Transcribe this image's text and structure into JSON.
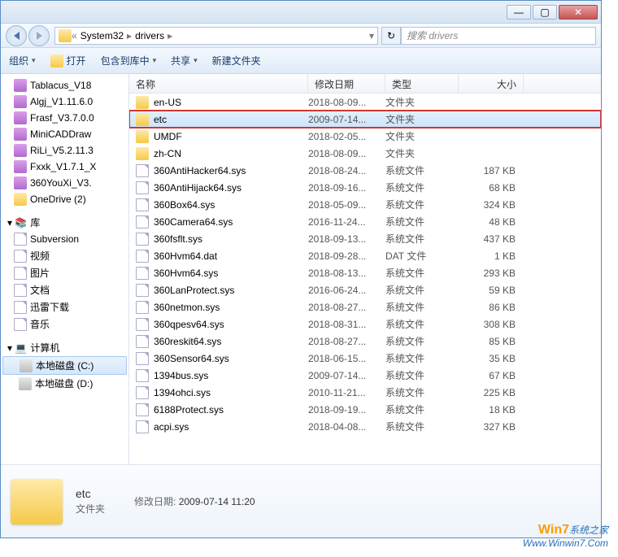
{
  "titlebar": {
    "min": "—",
    "max": "▢",
    "close": "✕"
  },
  "breadcrumb": {
    "a": "System32",
    "b": "drivers"
  },
  "search": {
    "placeholder": "搜索 drivers"
  },
  "toolbar": {
    "org": "组织",
    "open": "打开",
    "include": "包含到库中",
    "share": "共享",
    "newfolder": "新建文件夹"
  },
  "tree_top": [
    {
      "icon": "rar",
      "label": "Tablacus_V18"
    },
    {
      "icon": "rar",
      "label": "Algj_V1.11.6.0"
    },
    {
      "icon": "rar",
      "label": "Frasf_V3.7.0.0"
    },
    {
      "icon": "rar",
      "label": "MiniCADDraw"
    },
    {
      "icon": "rar",
      "label": "RiLi_V5.2.11.3"
    },
    {
      "icon": "rar",
      "label": "Fxxk_V1.7.1_X"
    },
    {
      "icon": "rar",
      "label": "360YouXi_V3."
    },
    {
      "icon": "folder",
      "label": "OneDrive (2)"
    }
  ],
  "tree_lib_label": "库",
  "tree_lib": [
    {
      "label": "Subversion"
    },
    {
      "label": "视频"
    },
    {
      "label": "图片"
    },
    {
      "label": "文档"
    },
    {
      "label": "迅雷下载"
    },
    {
      "label": "音乐"
    }
  ],
  "tree_comp_label": "计算机",
  "tree_comp": [
    {
      "label": "本地磁盘 (C:)",
      "sel": true
    },
    {
      "label": "本地磁盘 (D:)"
    }
  ],
  "columns": {
    "name": "名称",
    "date": "修改日期",
    "type": "类型",
    "size": "大小"
  },
  "files": [
    {
      "icon": "folder",
      "name": "en-US",
      "date": "2018-08-09...",
      "type": "文件夹",
      "size": ""
    },
    {
      "icon": "folder",
      "name": "etc",
      "date": "2009-07-14...",
      "type": "文件夹",
      "size": "",
      "sel": true,
      "hl": true
    },
    {
      "icon": "folder",
      "name": "UMDF",
      "date": "2018-02-05...",
      "type": "文件夹",
      "size": ""
    },
    {
      "icon": "folder",
      "name": "zh-CN",
      "date": "2018-08-09...",
      "type": "文件夹",
      "size": ""
    },
    {
      "icon": "file",
      "name": "360AntiHacker64.sys",
      "date": "2018-08-24...",
      "type": "系统文件",
      "size": "187 KB"
    },
    {
      "icon": "file",
      "name": "360AntiHijack64.sys",
      "date": "2018-09-16...",
      "type": "系统文件",
      "size": "68 KB"
    },
    {
      "icon": "file",
      "name": "360Box64.sys",
      "date": "2018-05-09...",
      "type": "系统文件",
      "size": "324 KB"
    },
    {
      "icon": "file",
      "name": "360Camera64.sys",
      "date": "2016-11-24...",
      "type": "系统文件",
      "size": "48 KB"
    },
    {
      "icon": "file",
      "name": "360fsflt.sys",
      "date": "2018-09-13...",
      "type": "系统文件",
      "size": "437 KB"
    },
    {
      "icon": "file",
      "name": "360Hvm64.dat",
      "date": "2018-09-28...",
      "type": "DAT 文件",
      "size": "1 KB"
    },
    {
      "icon": "file",
      "name": "360Hvm64.sys",
      "date": "2018-08-13...",
      "type": "系统文件",
      "size": "293 KB"
    },
    {
      "icon": "file",
      "name": "360LanProtect.sys",
      "date": "2016-06-24...",
      "type": "系统文件",
      "size": "59 KB"
    },
    {
      "icon": "file",
      "name": "360netmon.sys",
      "date": "2018-08-27...",
      "type": "系统文件",
      "size": "86 KB"
    },
    {
      "icon": "file",
      "name": "360qpesv64.sys",
      "date": "2018-08-31...",
      "type": "系统文件",
      "size": "308 KB"
    },
    {
      "icon": "file",
      "name": "360reskit64.sys",
      "date": "2018-08-27...",
      "type": "系统文件",
      "size": "85 KB"
    },
    {
      "icon": "file",
      "name": "360Sensor64.sys",
      "date": "2018-06-15...",
      "type": "系统文件",
      "size": "35 KB"
    },
    {
      "icon": "file",
      "name": "1394bus.sys",
      "date": "2009-07-14...",
      "type": "系统文件",
      "size": "67 KB"
    },
    {
      "icon": "file",
      "name": "1394ohci.sys",
      "date": "2010-11-21...",
      "type": "系统文件",
      "size": "225 KB"
    },
    {
      "icon": "file",
      "name": "6188Protect.sys",
      "date": "2018-09-19...",
      "type": "系统文件",
      "size": "18 KB"
    },
    {
      "icon": "file",
      "name": "acpi.sys",
      "date": "2018-04-08...",
      "type": "系统文件",
      "size": "327 KB"
    }
  ],
  "details": {
    "name": "etc",
    "type": "文件夹",
    "date_label": "修改日期:",
    "date": "2009-07-14 11:20"
  },
  "watermark": {
    "brand1": "Win7",
    "brand2": "系统之家",
    "url": "Www.Winwin7.Com"
  }
}
